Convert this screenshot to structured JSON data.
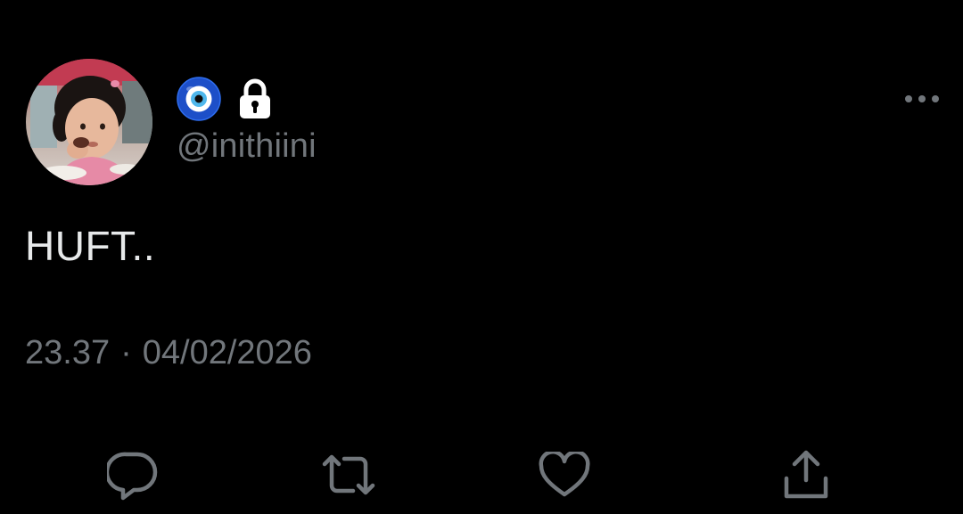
{
  "tweet": {
    "handle": "@inithiini",
    "text": "HUFT..",
    "time": "23.37",
    "separator": "·",
    "date": "04/02/2026"
  },
  "name_icons": [
    "nazar-amulet-icon",
    "lock-icon"
  ],
  "more_icon": "more-horizontal-icon",
  "actions": [
    {
      "name": "reply-button",
      "icon": "reply-icon"
    },
    {
      "name": "repost-button",
      "icon": "repost-icon"
    },
    {
      "name": "like-button",
      "icon": "heart-icon"
    },
    {
      "name": "share-button",
      "icon": "share-icon"
    }
  ],
  "colors": {
    "background": "#000000",
    "text": "#e7e9ea",
    "secondary": "#71767b",
    "nazar_blue": "#1d4fc8"
  }
}
